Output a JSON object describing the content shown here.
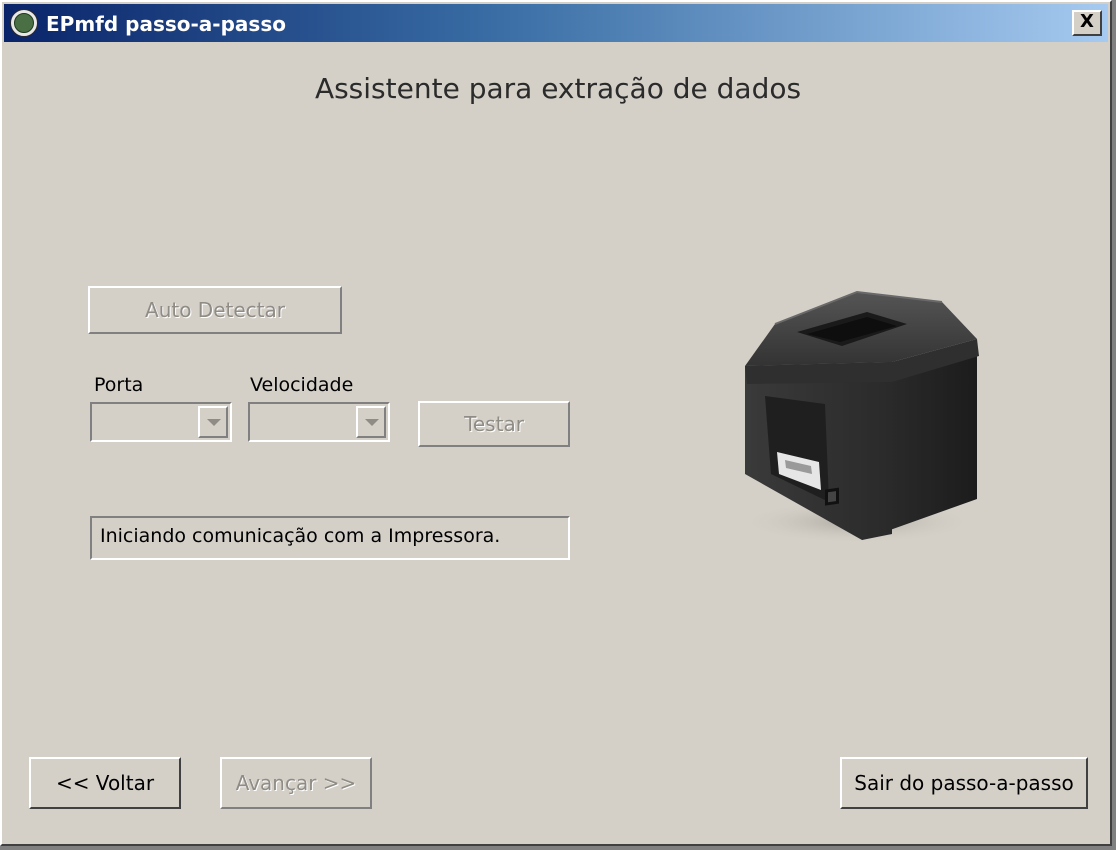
{
  "window": {
    "title": "EPmfd passo-a-passo",
    "close_label": "X"
  },
  "heading": "Assistente para extração de dados",
  "buttons": {
    "auto_detect": "Auto Detectar",
    "test": "Testar",
    "back": "<< Voltar",
    "next": "Avançar >>",
    "exit": "Sair do passo-a-passo"
  },
  "fields": {
    "port_label": "Porta",
    "port_value": "",
    "speed_label": "Velocidade",
    "speed_value": ""
  },
  "status_message": "Iniciando comunicação com a Impressora.",
  "icons": {
    "app": "app-logo-icon",
    "close": "close-icon",
    "dropdown": "chevron-down-icon",
    "illustration": "printer-icon"
  },
  "colors": {
    "titlebar_start": "#0a246a",
    "titlebar_end": "#a6caf0",
    "window_bg": "#d4d0c8",
    "disabled_text": "#8f8c86"
  }
}
